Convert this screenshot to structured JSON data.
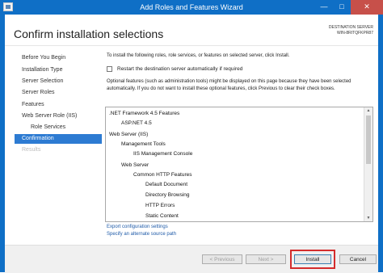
{
  "window": {
    "title": "Add Roles and Features Wizard",
    "minimize_glyph": "—",
    "maximize_glyph": "□",
    "close_glyph": "✕",
    "app_icon": "server-manager-icon"
  },
  "header": {
    "heading": "Confirm installation selections",
    "destination_label": "DESTINATION SERVER",
    "destination_server": "WIN-8RITQFKPR87"
  },
  "sidebar": {
    "items": [
      {
        "label": "Before You Begin",
        "state": "normal"
      },
      {
        "label": "Installation Type",
        "state": "normal"
      },
      {
        "label": "Server Selection",
        "state": "normal"
      },
      {
        "label": "Server Roles",
        "state": "normal"
      },
      {
        "label": "Features",
        "state": "normal"
      },
      {
        "label": "Web Server Role (IIS)",
        "state": "normal"
      },
      {
        "label": "Role Services",
        "state": "sub"
      },
      {
        "label": "Confirmation",
        "state": "active"
      },
      {
        "label": "Results",
        "state": "disabled"
      }
    ]
  },
  "content": {
    "intro": "To install the following roles, role services, or features on selected server, click Install.",
    "restart_checkbox": {
      "label": "Restart the destination server automatically if required",
      "checked": false
    },
    "optional_text": "Optional features (such as administration tools) might be displayed on this page because they have been selected automatically. If you do not want to install these optional features, click Previous to clear their check boxes.",
    "selections": [
      {
        "label": ".NET Framework 4.5 Features",
        "level": 0
      },
      {
        "label": "ASP.NET 4.5",
        "level": 1
      },
      {
        "label": "Web Server (IIS)",
        "level": 0
      },
      {
        "label": "Management Tools",
        "level": 1
      },
      {
        "label": "IIS Management Console",
        "level": 2
      },
      {
        "label": "Web Server",
        "level": 1
      },
      {
        "label": "Common HTTP Features",
        "level": 2
      },
      {
        "label": "Default Document",
        "level": 3
      },
      {
        "label": "Directory Browsing",
        "level": 3
      },
      {
        "label": "HTTP Errors",
        "level": 3
      },
      {
        "label": "Static Content",
        "level": 3
      }
    ],
    "export_link": "Export configuration settings",
    "alternate_source_link": "Specify an alternate source path"
  },
  "footer": {
    "previous": "< Previous",
    "next": "Next >",
    "install": "Install",
    "cancel": "Cancel"
  },
  "colors": {
    "titlebar": "#0f6fc6",
    "active_nav": "#2d7bd2",
    "close_button": "#c7504a",
    "highlight_box": "#d42c2c",
    "link": "#1e5aa8"
  }
}
